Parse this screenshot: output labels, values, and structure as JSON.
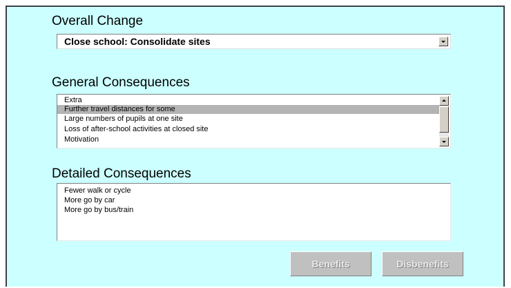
{
  "overall_change": {
    "title": "Overall Change",
    "selected": "Close school: Consolidate sites"
  },
  "general_consequences": {
    "title": "General Consequences",
    "items": [
      "Extra",
      "Further travel distances for some",
      "Large numbers of pupils at one site",
      "Loss of after-school activities at closed site",
      "Motivation"
    ],
    "selected_index": 1
  },
  "detailed_consequences": {
    "title": "Detailed Consequences",
    "items": [
      "Fewer walk or cycle",
      "More go by car",
      "More go by bus/train"
    ]
  },
  "buttons": {
    "benefits": "Benefits",
    "disbenefits": "Disbenefits"
  },
  "colors": {
    "panel_background": "#ccffff",
    "selection": "#b4b4b4"
  }
}
